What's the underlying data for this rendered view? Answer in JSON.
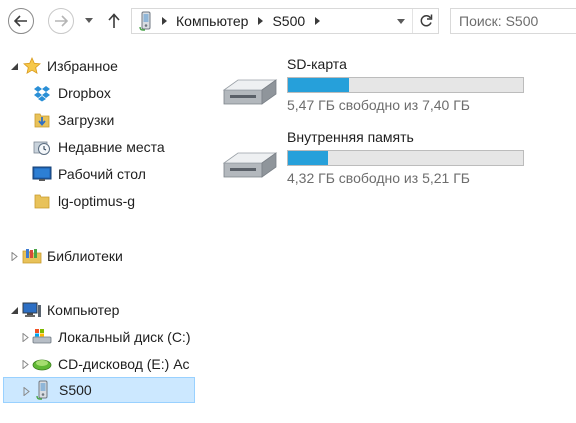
{
  "toolbar": {
    "breadcrumb": [
      "Компьютер",
      "S500"
    ],
    "search_placeholder": "Поиск: S500",
    "icons": {
      "back": "back-arrow-icon",
      "forward": "forward-arrow-icon",
      "history": "chevron-down-icon",
      "up": "up-arrow-icon",
      "location": "phone-device-icon",
      "refresh": "refresh-icon"
    }
  },
  "navigation": {
    "favorites": {
      "label": "Избранное",
      "items": [
        {
          "label": "Dropbox",
          "icon": "dropbox-icon"
        },
        {
          "label": "Загрузки",
          "icon": "downloads-folder-icon"
        },
        {
          "label": "Недавние места",
          "icon": "recent-places-icon"
        },
        {
          "label": "Рабочий стол",
          "icon": "desktop-icon"
        },
        {
          "label": "lg-optimus-g",
          "icon": "folder-icon"
        }
      ]
    },
    "libraries": {
      "label": "Библиотеки",
      "icon": "libraries-icon"
    },
    "computer": {
      "label": "Компьютер",
      "items": [
        {
          "label": "Локальный диск (C:)",
          "icon": "local-disk-icon"
        },
        {
          "label": "CD-дисковод (E:) Ac",
          "icon": "cd-drive-icon"
        },
        {
          "label": "S500",
          "icon": "phone-device-icon",
          "selected": true
        }
      ]
    }
  },
  "content": {
    "drives": [
      {
        "name": "SD-карта",
        "free_text": "5,47 ГБ свободно из 7,40 ГБ",
        "used_fraction": 0.26
      },
      {
        "name": "Внутренняя память",
        "free_text": "4,32 ГБ свободно из 5,21 ГБ",
        "used_fraction": 0.17
      }
    ]
  },
  "colors": {
    "selection_bg": "#cce8ff",
    "selection_border": "#99d1ff",
    "usage_bar_fill": "#26a0da",
    "usage_bar_bg": "#e6e6e6",
    "secondary_text": "#6d6d6d"
  }
}
